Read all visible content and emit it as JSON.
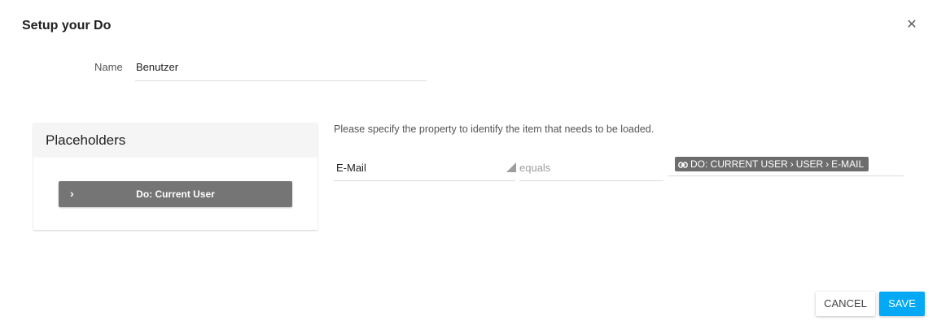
{
  "dialog": {
    "title": "Setup your Do",
    "close_icon": "close-icon"
  },
  "name": {
    "label": "Name",
    "value": "Benutzer"
  },
  "placeholders": {
    "title": "Placeholders",
    "items": [
      {
        "label": "Do: Current User",
        "icon": "chevron-right-icon"
      }
    ]
  },
  "filter": {
    "instruction": "Please specify the property to identify the item that needs to be loaded.",
    "property": "E-Mail",
    "operator": "equals",
    "value_chip": {
      "icon": "link-icon",
      "parts": [
        "DO: CURRENT USER",
        "USER",
        "E-MAIL"
      ],
      "separator": "›"
    }
  },
  "actions": {
    "cancel": "CANCEL",
    "save": "SAVE",
    "save_color": "#03a9f4"
  }
}
